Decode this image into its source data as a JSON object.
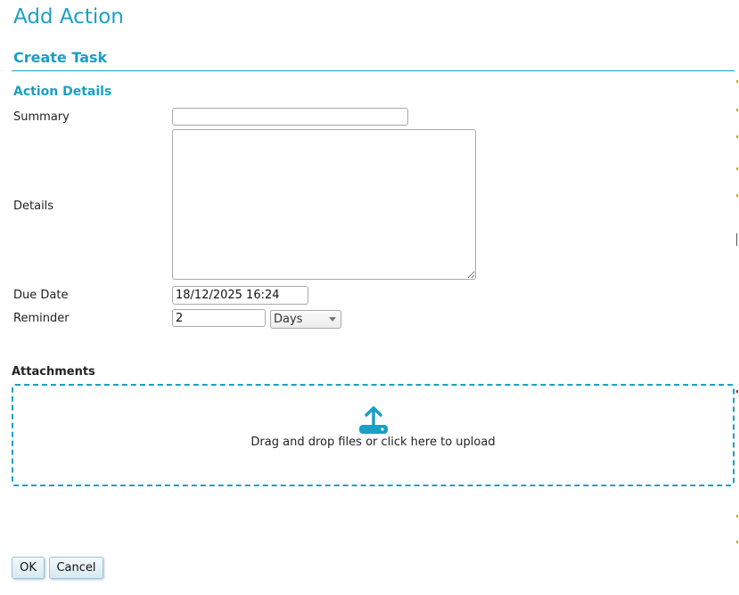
{
  "page": {
    "title": "Add Action"
  },
  "section": {
    "title": "Create Task"
  },
  "action_details": {
    "title": "Action Details",
    "summary": {
      "label": "Summary",
      "value": ""
    },
    "details": {
      "label": "Details",
      "value": ""
    },
    "due_date": {
      "label": "Due Date",
      "value": "18/12/2025 16:24"
    },
    "reminder": {
      "label": "Reminder",
      "value": "2",
      "unit_selected": "Days"
    }
  },
  "attachments": {
    "label": "Attachments",
    "dropzone_text": "Drag and drop files or click here to upload",
    "icon": "upload-icon"
  },
  "buttons": {
    "ok": "OK",
    "cancel": "Cancel"
  },
  "colors": {
    "accent": "#1a9fc7",
    "button_bg": "#d6e9f1"
  }
}
